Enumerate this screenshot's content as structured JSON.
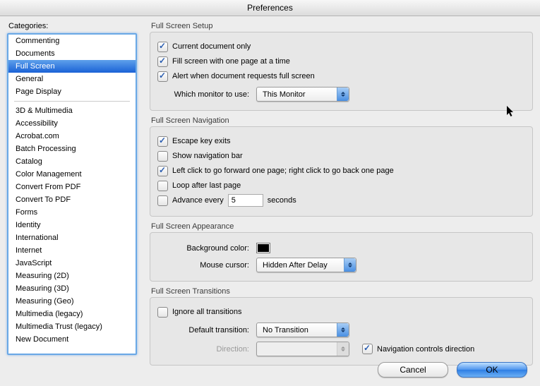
{
  "window": {
    "title": "Preferences"
  },
  "sidebar": {
    "label": "Categories:",
    "primary": [
      "Commenting",
      "Documents",
      "Full Screen",
      "General",
      "Page Display"
    ],
    "selected_index": 2,
    "secondary": [
      "3D & Multimedia",
      "Accessibility",
      "Acrobat.com",
      "Batch Processing",
      "Catalog",
      "Color Management",
      "Convert From PDF",
      "Convert To PDF",
      "Forms",
      "Identity",
      "International",
      "Internet",
      "JavaScript",
      "Measuring (2D)",
      "Measuring (3D)",
      "Measuring (Geo)",
      "Multimedia (legacy)",
      "Multimedia Trust (legacy)",
      "New Document"
    ]
  },
  "setup": {
    "title": "Full Screen Setup",
    "current_doc_only": {
      "label": "Current document only",
      "checked": true
    },
    "fill_one_page": {
      "label": "Fill screen with one page at a time",
      "checked": true
    },
    "alert_request": {
      "label": "Alert when document requests full screen",
      "checked": true
    },
    "monitor_label": "Which monitor to use:",
    "monitor_value": "This Monitor"
  },
  "nav": {
    "title": "Full Screen Navigation",
    "escape_exits": {
      "label": "Escape key exits",
      "checked": true
    },
    "show_nav_bar": {
      "label": "Show navigation bar",
      "checked": false
    },
    "click_paging": {
      "label": "Left click to go forward one page; right click to go back one page",
      "checked": true
    },
    "loop_last": {
      "label": "Loop after last page",
      "checked": false
    },
    "advance_every": {
      "label": "Advance every",
      "checked": false,
      "value": "5",
      "suffix": "seconds"
    }
  },
  "appearance": {
    "title": "Full Screen Appearance",
    "bg_label": "Background color:",
    "bg_color": "#000000",
    "cursor_label": "Mouse cursor:",
    "cursor_value": "Hidden After Delay"
  },
  "transitions": {
    "title": "Full Screen Transitions",
    "ignore_all": {
      "label": "Ignore all transitions",
      "checked": false
    },
    "default_label": "Default transition:",
    "default_value": "No Transition",
    "direction_label": "Direction:",
    "direction_value": "",
    "nav_controls": {
      "label": "Navigation controls direction",
      "checked": true
    }
  },
  "buttons": {
    "cancel": "Cancel",
    "ok": "OK"
  }
}
